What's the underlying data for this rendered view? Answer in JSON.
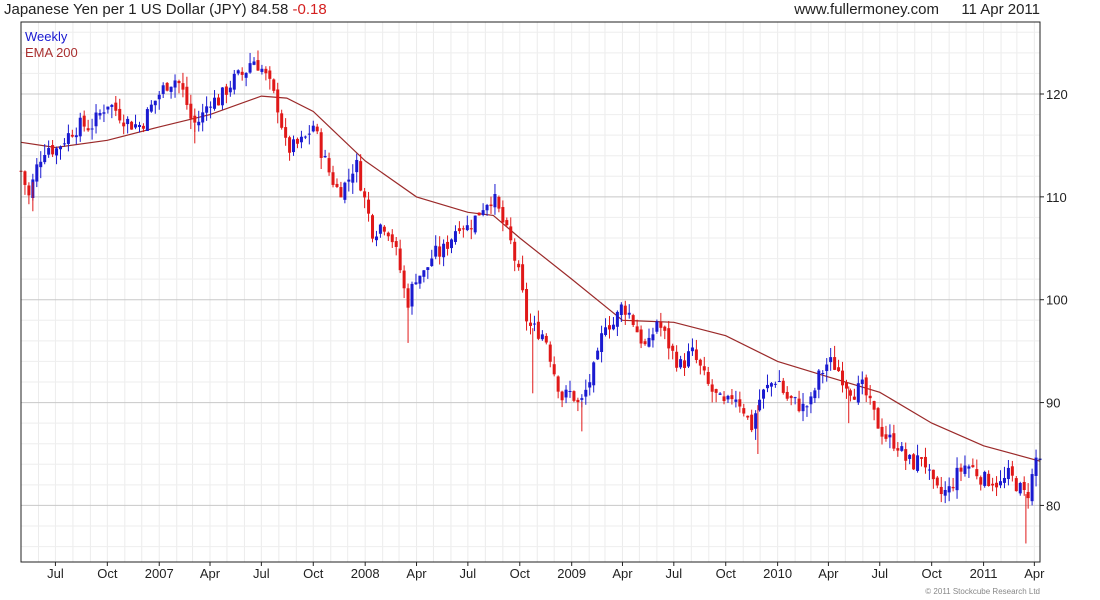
{
  "header": {
    "title": "Japanese Yen per 1 US Dollar (JPY)",
    "last_price": "84.58",
    "change": "-0.18",
    "site": "www.fullermoney.com",
    "date": "11 Apr 2011"
  },
  "legend": {
    "series1": "Weekly",
    "series2": "EMA 200"
  },
  "copyright": "© 2011 Stockcube Research Ltd",
  "colors": {
    "up": "#1a1ad0",
    "down": "#e01818",
    "ema": "#9b2a2a",
    "grid": "#d8d8d8",
    "frame": "#222222"
  },
  "chart_data": {
    "type": "candlestick",
    "interval": "weekly",
    "x_range": [
      "2006-05-01",
      "2011-04-11"
    ],
    "ylim": [
      74.5,
      127
    ],
    "y_ticks": [
      80,
      90,
      100,
      110,
      120
    ],
    "y_axis_side": "right",
    "grid": true,
    "x_ticks": [
      {
        "label": "Jul",
        "date": "2006-07-01"
      },
      {
        "label": "Oct",
        "date": "2006-10-01"
      },
      {
        "label": "2007",
        "date": "2007-01-01"
      },
      {
        "label": "Apr",
        "date": "2007-04-01"
      },
      {
        "label": "Jul",
        "date": "2007-07-01"
      },
      {
        "label": "Oct",
        "date": "2007-10-01"
      },
      {
        "label": "2008",
        "date": "2008-01-01"
      },
      {
        "label": "Apr",
        "date": "2008-04-01"
      },
      {
        "label": "Jul",
        "date": "2008-07-01"
      },
      {
        "label": "Oct",
        "date": "2008-10-01"
      },
      {
        "label": "2009",
        "date": "2009-01-01"
      },
      {
        "label": "Apr",
        "date": "2009-04-01"
      },
      {
        "label": "Jul",
        "date": "2009-07-01"
      },
      {
        "label": "Oct",
        "date": "2009-10-01"
      },
      {
        "label": "2010",
        "date": "2010-01-01"
      },
      {
        "label": "Apr",
        "date": "2010-04-01"
      },
      {
        "label": "Jul",
        "date": "2010-07-01"
      },
      {
        "label": "Oct",
        "date": "2010-10-01"
      },
      {
        "label": "2011",
        "date": "2011-01-01"
      },
      {
        "label": "Apr",
        "date": "2011-04-01"
      }
    ],
    "series": [
      {
        "name": "Weekly",
        "close_points": [
          [
            "2006-05-01",
            112.5
          ],
          [
            "2006-05-15",
            110.0
          ],
          [
            "2006-06-01",
            113.5
          ],
          [
            "2006-06-15",
            115.0
          ],
          [
            "2006-07-01",
            114.5
          ],
          [
            "2006-07-15",
            115.5
          ],
          [
            "2006-08-01",
            116.5
          ],
          [
            "2006-08-15",
            117.0
          ],
          [
            "2006-09-01",
            116.8
          ],
          [
            "2006-09-15",
            117.8
          ],
          [
            "2006-10-01",
            119.2
          ],
          [
            "2006-10-15",
            118.5
          ],
          [
            "2006-11-01",
            117.5
          ],
          [
            "2006-11-15",
            117.0
          ],
          [
            "2006-12-01",
            117.0
          ],
          [
            "2006-12-15",
            118.5
          ],
          [
            "2007-01-01",
            120.0
          ],
          [
            "2007-01-15",
            121.0
          ],
          [
            "2007-02-01",
            121.5
          ],
          [
            "2007-02-15",
            119.8
          ],
          [
            "2007-03-01",
            117.0
          ],
          [
            "2007-03-15",
            117.5
          ],
          [
            "2007-04-01",
            119.5
          ],
          [
            "2007-04-15",
            119.3
          ],
          [
            "2007-05-01",
            120.5
          ],
          [
            "2007-05-15",
            121.5
          ],
          [
            "2007-06-01",
            122.0
          ],
          [
            "2007-06-15",
            123.5
          ],
          [
            "2007-07-01",
            122.5
          ],
          [
            "2007-07-15",
            121.0
          ],
          [
            "2007-08-01",
            118.5
          ],
          [
            "2007-08-15",
            114.5
          ],
          [
            "2007-09-01",
            115.0
          ],
          [
            "2007-09-15",
            115.5
          ],
          [
            "2007-10-01",
            117.0
          ],
          [
            "2007-10-15",
            114.5
          ],
          [
            "2007-11-01",
            112.0
          ],
          [
            "2007-11-15",
            110.5
          ],
          [
            "2007-12-01",
            111.5
          ],
          [
            "2007-12-15",
            113.5
          ],
          [
            "2008-01-01",
            109.5
          ],
          [
            "2008-01-15",
            106.5
          ],
          [
            "2008-02-01",
            107.5
          ],
          [
            "2008-02-15",
            106.5
          ],
          [
            "2008-03-01",
            103.5
          ],
          [
            "2008-03-15",
            99.5
          ],
          [
            "2008-04-01",
            102.5
          ],
          [
            "2008-04-15",
            102.5
          ],
          [
            "2008-05-01",
            104.5
          ],
          [
            "2008-05-15",
            104.5
          ],
          [
            "2008-06-01",
            106.0
          ],
          [
            "2008-06-15",
            107.5
          ],
          [
            "2008-07-01",
            107.0
          ],
          [
            "2008-07-15",
            108.0
          ],
          [
            "2008-08-01",
            109.5
          ],
          [
            "2008-08-15",
            110.0
          ],
          [
            "2008-09-01",
            107.5
          ],
          [
            "2008-09-15",
            105.5
          ],
          [
            "2008-10-01",
            102.0
          ],
          [
            "2008-10-15",
            97.5
          ],
          [
            "2008-11-01",
            97.0
          ],
          [
            "2008-11-15",
            96.5
          ],
          [
            "2008-12-01",
            93.0
          ],
          [
            "2008-12-15",
            90.5
          ],
          [
            "2009-01-01",
            91.0
          ],
          [
            "2009-01-15",
            89.5
          ],
          [
            "2009-02-01",
            92.0
          ],
          [
            "2009-02-15",
            94.0
          ],
          [
            "2009-03-01",
            98.0
          ],
          [
            "2009-03-15",
            97.5
          ],
          [
            "2009-04-01",
            99.5
          ],
          [
            "2009-04-15",
            98.5
          ],
          [
            "2009-05-01",
            96.5
          ],
          [
            "2009-05-15",
            95.0
          ],
          [
            "2009-06-01",
            98.0
          ],
          [
            "2009-06-15",
            96.5
          ],
          [
            "2009-07-01",
            94.5
          ],
          [
            "2009-07-15",
            93.5
          ],
          [
            "2009-08-01",
            95.0
          ],
          [
            "2009-08-15",
            93.5
          ],
          [
            "2009-09-01",
            91.5
          ],
          [
            "2009-09-15",
            90.5
          ],
          [
            "2009-10-01",
            89.5
          ],
          [
            "2009-10-15",
            91.0
          ],
          [
            "2009-11-01",
            89.5
          ],
          [
            "2009-11-15",
            87.5
          ],
          [
            "2009-12-01",
            90.5
          ],
          [
            "2009-12-15",
            91.5
          ],
          [
            "2010-01-01",
            92.5
          ],
          [
            "2010-01-15",
            90.5
          ],
          [
            "2010-02-01",
            90.0
          ],
          [
            "2010-02-15",
            89.5
          ],
          [
            "2010-03-01",
            90.0
          ],
          [
            "2010-03-15",
            92.5
          ],
          [
            "2010-04-01",
            94.0
          ],
          [
            "2010-04-15",
            93.5
          ],
          [
            "2010-05-01",
            92.0
          ],
          [
            "2010-05-15",
            91.0
          ],
          [
            "2010-06-01",
            91.5
          ],
          [
            "2010-06-15",
            89.5
          ],
          [
            "2010-07-01",
            87.5
          ],
          [
            "2010-07-15",
            86.5
          ],
          [
            "2010-08-01",
            86.0
          ],
          [
            "2010-08-15",
            84.5
          ],
          [
            "2010-09-01",
            84.0
          ],
          [
            "2010-09-15",
            85.0
          ],
          [
            "2010-10-01",
            82.0
          ],
          [
            "2010-10-15",
            81.0
          ],
          [
            "2010-11-01",
            81.5
          ],
          [
            "2010-11-15",
            83.0
          ],
          [
            "2010-12-01",
            84.0
          ],
          [
            "2010-12-15",
            83.5
          ],
          [
            "2011-01-01",
            82.5
          ],
          [
            "2011-01-15",
            82.5
          ],
          [
            "2011-02-01",
            82.0
          ],
          [
            "2011-02-15",
            83.0
          ],
          [
            "2011-03-01",
            82.0
          ],
          [
            "2011-03-15",
            81.0
          ],
          [
            "2011-03-25",
            81.5
          ],
          [
            "2011-04-01",
            84.5
          ],
          [
            "2011-04-11",
            84.58
          ]
        ],
        "spikes": [
          {
            "date": "2006-05-22",
            "low": 108.6
          },
          {
            "date": "2007-03-05",
            "low": 115.2
          },
          {
            "date": "2008-03-17",
            "low": 95.8
          },
          {
            "date": "2008-10-24",
            "low": 90.9
          },
          {
            "date": "2009-01-19",
            "low": 87.2
          },
          {
            "date": "2009-11-27",
            "low": 85.0
          },
          {
            "date": "2010-05-07",
            "low": 88.0
          },
          {
            "date": "2011-03-17",
            "low": 76.3
          }
        ]
      },
      {
        "name": "EMA 200",
        "points": [
          [
            "2006-05-01",
            115.3
          ],
          [
            "2006-07-01",
            114.8
          ],
          [
            "2006-10-01",
            115.5
          ],
          [
            "2007-01-01",
            116.8
          ],
          [
            "2007-04-01",
            118.0
          ],
          [
            "2007-07-01",
            119.8
          ],
          [
            "2007-08-15",
            119.6
          ],
          [
            "2007-10-01",
            118.3
          ],
          [
            "2008-01-01",
            113.5
          ],
          [
            "2008-04-01",
            110.0
          ],
          [
            "2008-07-01",
            108.5
          ],
          [
            "2008-08-15",
            108.2
          ],
          [
            "2008-10-01",
            106.0
          ],
          [
            "2009-01-01",
            102.0
          ],
          [
            "2009-04-01",
            98.0
          ],
          [
            "2009-07-01",
            97.8
          ],
          [
            "2009-10-01",
            96.5
          ],
          [
            "2010-01-01",
            94.0
          ],
          [
            "2010-04-01",
            92.5
          ],
          [
            "2010-07-01",
            91.0
          ],
          [
            "2010-10-01",
            88.0
          ],
          [
            "2011-01-01",
            85.8
          ],
          [
            "2011-04-11",
            84.3
          ]
        ]
      }
    ]
  }
}
